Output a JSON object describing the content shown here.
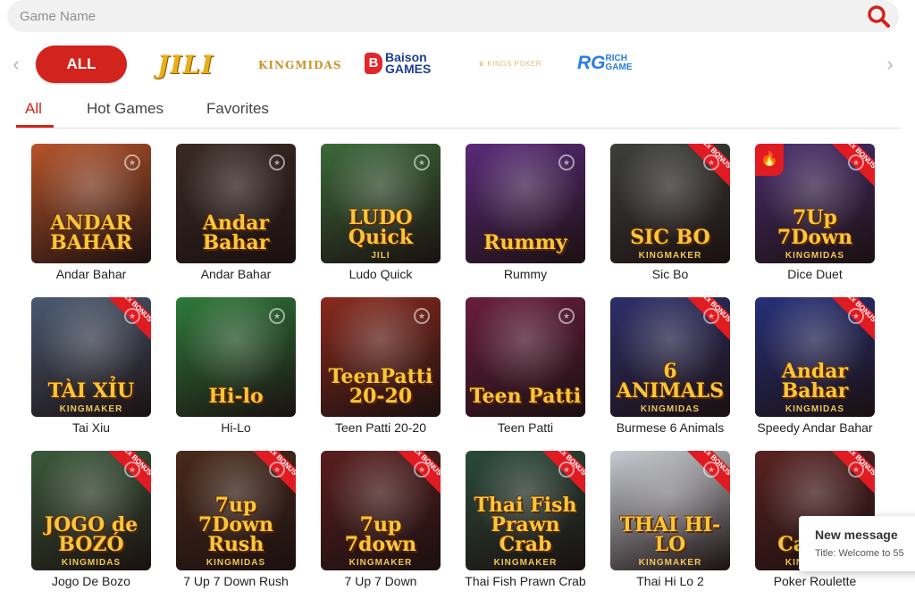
{
  "search": {
    "placeholder": "Game Name"
  },
  "providers": {
    "all_label": "ALL",
    "jili": "JILI",
    "kingmidas": "KINGMIDAS",
    "baison": {
      "b": "B",
      "line1": "Baison",
      "line2": "GAMES"
    },
    "kingsfour": "KINGS POKER",
    "rg": {
      "big": "RG",
      "small1": "RICH",
      "small2": "GAME"
    }
  },
  "tabs": [
    {
      "label": "All",
      "active": true
    },
    {
      "label": "Hot Games",
      "active": false
    },
    {
      "label": "Favorites",
      "active": false
    }
  ],
  "games": [
    {
      "name": "Andar Bahar",
      "art": "ANDAR BAHAR",
      "brand": "",
      "bonus": false,
      "hot": false,
      "color": "#b8542a"
    },
    {
      "name": "Andar Bahar",
      "art": "Andar Bahar",
      "brand": "",
      "bonus": false,
      "hot": false,
      "color": "#3a2a24"
    },
    {
      "name": "Ludo Quick",
      "art": "LUDO Quick",
      "brand": "JILI",
      "bonus": false,
      "hot": false,
      "color": "#3c6a3a"
    },
    {
      "name": "Rummy",
      "art": "Rummy",
      "brand": "",
      "bonus": false,
      "hot": false,
      "color": "#5b2a7a"
    },
    {
      "name": "Sic Bo",
      "art": "SIC BO",
      "brand": "KINGMAKER",
      "bonus": true,
      "hot": false,
      "color": "#3d3f3a"
    },
    {
      "name": "Dice Duet",
      "art": "7Up 7Down",
      "brand": "KINGMIDAS",
      "bonus": true,
      "hot": true,
      "color": "#4a2c6e"
    },
    {
      "name": "Tai Xiu",
      "art": "TÀI XỈU",
      "brand": "KINGMAKER",
      "bonus": true,
      "hot": false,
      "color": "#4a5a72"
    },
    {
      "name": "Hi-Lo",
      "art": "Hi-lo",
      "brand": "",
      "bonus": false,
      "hot": false,
      "color": "#2e7a3a"
    },
    {
      "name": "Teen Patti 20-20",
      "art": "TeenPatti 20-20",
      "brand": "",
      "bonus": false,
      "hot": false,
      "color": "#8a2a1e"
    },
    {
      "name": "Teen Patti",
      "art": "Teen Patti",
      "brand": "",
      "bonus": false,
      "hot": false,
      "color": "#6a1e3e"
    },
    {
      "name": "Burmese 6 Animals",
      "art": "6 ANIMALS",
      "brand": "KINGMIDAS",
      "bonus": true,
      "hot": false,
      "color": "#2d2f6a"
    },
    {
      "name": "Speedy Andar Bahar",
      "art": "Andar Bahar",
      "brand": "KINGMIDAS",
      "bonus": true,
      "hot": false,
      "color": "#26307a"
    },
    {
      "name": "Jogo De Bozo",
      "art": "JOGO de BOZÓ",
      "brand": "KINGMIDAS",
      "bonus": true,
      "hot": false,
      "color": "#3a5a3a"
    },
    {
      "name": "7 Up 7 Down Rush",
      "art": "7up 7Down Rush",
      "brand": "KINGMIDAS",
      "bonus": true,
      "hot": false,
      "color": "#4a2a1a"
    },
    {
      "name": "7 Up 7 Down",
      "art": "7up 7down",
      "brand": "KINGMAKER",
      "bonus": true,
      "hot": false,
      "color": "#5a1e1e"
    },
    {
      "name": "Thai Fish Prawn Crab",
      "art": "Thai Fish Prawn Crab",
      "brand": "KINGMAKER",
      "bonus": true,
      "hot": false,
      "color": "#2a4a3a"
    },
    {
      "name": "Thai Hi Lo 2",
      "art": "THAI HI-LO",
      "brand": "KINGMAKER",
      "bonus": true,
      "hot": false,
      "color": "#c8ccd2"
    },
    {
      "name": "Poker Roulette",
      "art": "Casino",
      "brand": "KINGMIDAS",
      "bonus": true,
      "hot": false,
      "color": "#5a2222"
    }
  ],
  "bonus_text": "2x BONUS",
  "toast": {
    "title": "New message",
    "body": "Title: Welcome to 55"
  },
  "colors": {
    "accent": "#d2231c",
    "bonus": "#e01b22"
  }
}
